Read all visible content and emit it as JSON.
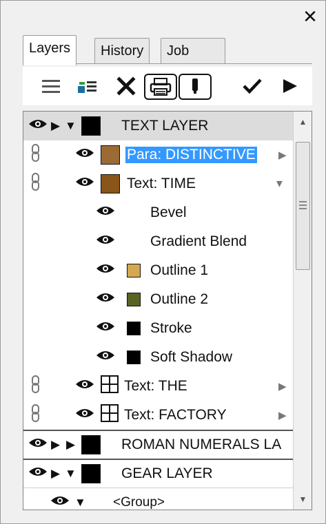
{
  "panel": {
    "close_label": "✕"
  },
  "tabs": [
    {
      "label": "Layers",
      "active": true
    },
    {
      "label": "History",
      "active": false
    },
    {
      "label": "Job",
      "active": false
    }
  ],
  "toolbar": {
    "menu_icon": "menu-icon",
    "layer_options_icon": "layer-options-icon",
    "delete_icon": "delete-icon",
    "print_icon": "print-icon",
    "lock_icon": "lock-toggle-icon",
    "apply_icon": "checkmark-icon",
    "play_icon": "play-icon"
  },
  "tree": {
    "rows": [
      {
        "label": "TEXT LAYER"
      },
      {
        "label": "Para: DISTINCTIVE",
        "selected": true,
        "color": "#9b6a35"
      },
      {
        "label": "Text: TIME",
        "color": "#8a5518"
      },
      {
        "label": "Bevel"
      },
      {
        "label": "Gradient Blend"
      },
      {
        "label": "Outline 1",
        "color": "#d4a850"
      },
      {
        "label": "Outline 2",
        "color": "#5a6323"
      },
      {
        "label": "Stroke",
        "color": "#000000"
      },
      {
        "label": "Soft Shadow",
        "color": "#000000"
      },
      {
        "label": "Text: THE"
      },
      {
        "label": "Text: FACTORY"
      },
      {
        "label": "ROMAN NUMERALS LA"
      },
      {
        "label": "GEAR LAYER"
      },
      {
        "label": "<Group>"
      }
    ]
  },
  "colors": {
    "selection": "#3399ff",
    "layer_header": "#dcdcdc"
  }
}
